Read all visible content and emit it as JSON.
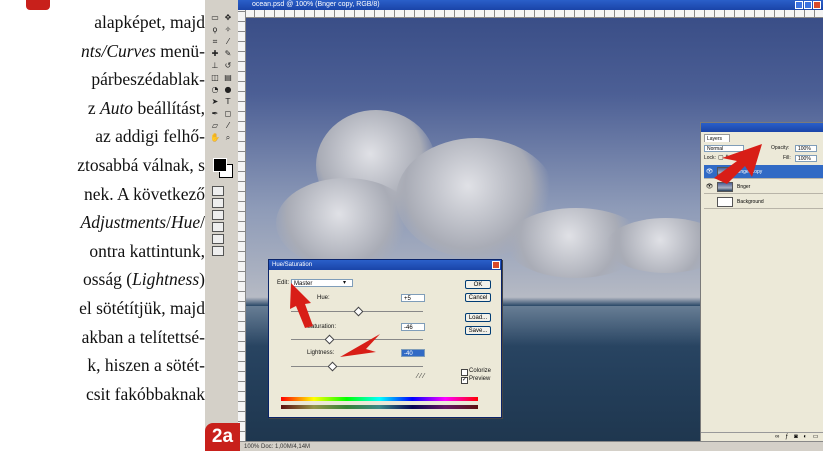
{
  "article": {
    "lines": [
      {
        "parts": [
          {
            "t": "alapképet, majd",
            "i": false
          }
        ]
      },
      {
        "parts": [
          {
            "t": "nts/Curves",
            "i": true
          },
          {
            "t": " menü-",
            "i": false
          }
        ]
      },
      {
        "parts": [
          {
            "t": "párbeszédablak-",
            "i": false
          }
        ]
      },
      {
        "parts": [
          {
            "t": "z ",
            "i": false
          },
          {
            "t": "Auto",
            "i": true
          },
          {
            "t": " beállítást,",
            "i": false
          }
        ]
      },
      {
        "parts": [
          {
            "t": "az addigi felhő-",
            "i": false
          }
        ]
      },
      {
        "parts": [
          {
            "t": "ztosabbá válnak, s",
            "i": false
          }
        ]
      },
      {
        "parts": [
          {
            "t": "nek. A következő",
            "i": false
          }
        ]
      },
      {
        "parts": [
          {
            "t": "Adjustments",
            "i": true
          },
          {
            "t": "/",
            "i": false
          },
          {
            "t": "Hue",
            "i": true
          },
          {
            "t": "/",
            "i": false
          }
        ]
      },
      {
        "parts": [
          {
            "t": "ontra kattintunk,",
            "i": false
          }
        ]
      },
      {
        "parts": [
          {
            "t": "osság (",
            "i": false
          },
          {
            "t": "Lightness",
            "i": true
          },
          {
            "t": ")",
            "i": false
          }
        ]
      },
      {
        "parts": [
          {
            "t": "el sötétítjük, majd",
            "i": false
          }
        ]
      },
      {
        "parts": [
          {
            "t": "akban a telítettsé-",
            "i": false
          }
        ]
      },
      {
        "parts": [
          {
            "t": "k, hiszen a sötét-",
            "i": false
          }
        ]
      },
      {
        "parts": [
          {
            "t": "csit fakóbbaknak",
            "i": false
          }
        ]
      }
    ]
  },
  "figure_label": "2a",
  "photoshop": {
    "doc_title": "ocean.psd @ 100% (Bnger copy, RGB/8)",
    "status": "100%   Doc: 1,00M/4,14M",
    "hue_sat": {
      "title": "Hue/Saturation",
      "edit_label": "Edit:",
      "edit_value": "Master",
      "hue_label": "Hue:",
      "hue_value": "+5",
      "saturation_label": "Saturation:",
      "saturation_value": "-46",
      "lightness_label": "Lightness:",
      "lightness_value": "-40",
      "ok_label": "OK",
      "cancel_label": "Cancel",
      "load_label": "Load...",
      "save_label": "Save...",
      "colorize_label": "Colorize",
      "colorize_checked": false,
      "preview_label": "Preview",
      "preview_checked": true
    },
    "layers": {
      "tab": "Layers",
      "blend_mode": "Normal",
      "opacity_label": "Opacity:",
      "opacity_value": "100%",
      "lock_label": "Lock:",
      "fill_label": "Fill:",
      "fill_value": "100%",
      "items": [
        {
          "name": "Bnger copy",
          "selected": true,
          "visible": true
        },
        {
          "name": "Bnger",
          "selected": false,
          "visible": true
        },
        {
          "name": "Background",
          "selected": false,
          "visible": false,
          "locked": true
        }
      ]
    }
  },
  "colors": {
    "accent_red": "#c8201b",
    "selection_blue": "#316ac5",
    "titlebar_blue": "#1a44a8"
  }
}
